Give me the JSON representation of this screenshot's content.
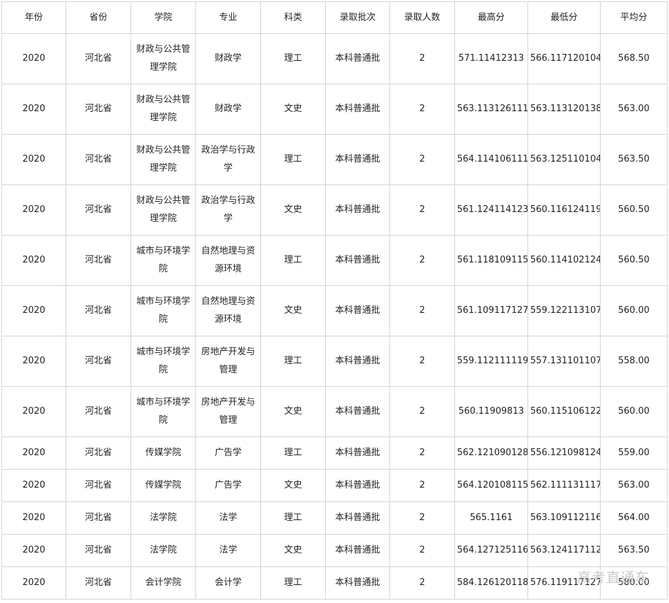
{
  "table": {
    "headers": [
      "年份",
      "省份",
      "学院",
      "专业",
      "科类",
      "录取批次",
      "录取人数",
      "最高分",
      "最低分",
      "平均分"
    ],
    "rows": [
      [
        "2020",
        "河北省",
        "财政与公共管理学院",
        "财政学",
        "理工",
        "本科普通批",
        "2",
        "571.11412313",
        "566.117120104",
        "568.50"
      ],
      [
        "2020",
        "河北省",
        "财政与公共管理学院",
        "财政学",
        "文史",
        "本科普通批",
        "2",
        "563.113126111",
        "563.113120138",
        "563.00"
      ],
      [
        "2020",
        "河北省",
        "财政与公共管理学院",
        "政治学与行政学",
        "理工",
        "本科普通批",
        "2",
        "564.114106111",
        "563.125110104",
        "563.50"
      ],
      [
        "2020",
        "河北省",
        "财政与公共管理学院",
        "政治学与行政学",
        "文史",
        "本科普通批",
        "2",
        "561.124114123",
        "560.116124119",
        "560.50"
      ],
      [
        "2020",
        "河北省",
        "城市与环境学院",
        "自然地理与资源环境",
        "理工",
        "本科普通批",
        "2",
        "561.118109115",
        "560.114102124",
        "560.50"
      ],
      [
        "2020",
        "河北省",
        "城市与环境学院",
        "自然地理与资源环境",
        "文史",
        "本科普通批",
        "2",
        "561.109117127",
        "559.122113107",
        "560.00"
      ],
      [
        "2020",
        "河北省",
        "城市与环境学院",
        "房地产开发与管理",
        "理工",
        "本科普通批",
        "2",
        "559.112111119",
        "557.131101107",
        "558.00"
      ],
      [
        "2020",
        "河北省",
        "城市与环境学院",
        "房地产开发与管理",
        "文史",
        "本科普通批",
        "2",
        "560.11909813",
        "560.115106122",
        "560.00"
      ],
      [
        "2020",
        "河北省",
        "传媒学院",
        "广告学",
        "理工",
        "本科普通批",
        "2",
        "562.121090128",
        "556.121098124",
        "559.00"
      ],
      [
        "2020",
        "河北省",
        "传媒学院",
        "广告学",
        "文史",
        "本科普通批",
        "2",
        "564.120108115",
        "562.111131117",
        "563.00"
      ],
      [
        "2020",
        "河北省",
        "法学院",
        "法学",
        "理工",
        "本科普通批",
        "2",
        "565.1161",
        "563.109112116",
        "564.00"
      ],
      [
        "2020",
        "河北省",
        "法学院",
        "法学",
        "文史",
        "本科普通批",
        "2",
        "564.127125116",
        "563.124117112",
        "563.50"
      ],
      [
        "2020",
        "河北省",
        "会计学院",
        "会计学",
        "理工",
        "本科普通批",
        "2",
        "584.126120118",
        "576.119117127",
        "580.00"
      ]
    ]
  },
  "watermark": "高考直通车"
}
